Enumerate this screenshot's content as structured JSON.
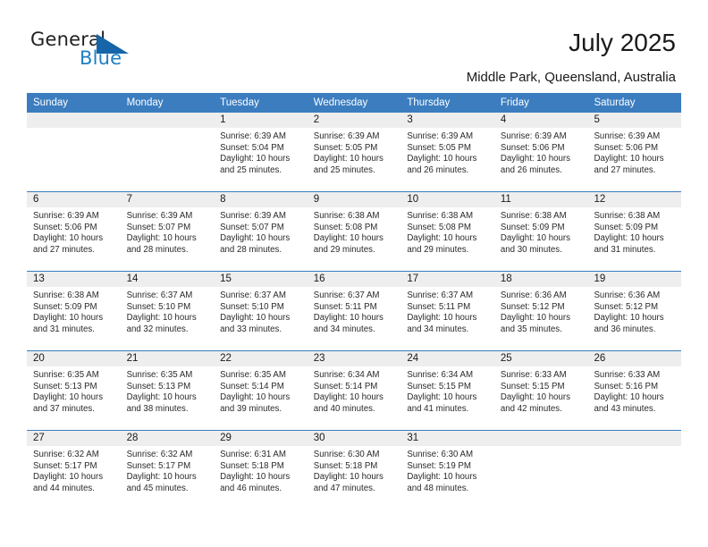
{
  "brand": {
    "name_top": "General",
    "name_bottom": "Blue",
    "accent_color": "#1565a8",
    "text_color": "#231f20"
  },
  "header": {
    "title": "July 2025",
    "subtitle": "Middle Park, Queensland, Australia"
  },
  "theme": {
    "header_blue": "#3b7dbf",
    "daynum_band": "#eeeeee"
  },
  "weekdays": [
    "Sunday",
    "Monday",
    "Tuesday",
    "Wednesday",
    "Thursday",
    "Friday",
    "Saturday"
  ],
  "weeks": [
    [
      {
        "day": "",
        "sunrise": "",
        "sunset": "",
        "daylight1": "",
        "daylight2": ""
      },
      {
        "day": "",
        "sunrise": "",
        "sunset": "",
        "daylight1": "",
        "daylight2": ""
      },
      {
        "day": "1",
        "sunrise": "Sunrise: 6:39 AM",
        "sunset": "Sunset: 5:04 PM",
        "daylight1": "Daylight: 10 hours",
        "daylight2": "and 25 minutes."
      },
      {
        "day": "2",
        "sunrise": "Sunrise: 6:39 AM",
        "sunset": "Sunset: 5:05 PM",
        "daylight1": "Daylight: 10 hours",
        "daylight2": "and 25 minutes."
      },
      {
        "day": "3",
        "sunrise": "Sunrise: 6:39 AM",
        "sunset": "Sunset: 5:05 PM",
        "daylight1": "Daylight: 10 hours",
        "daylight2": "and 26 minutes."
      },
      {
        "day": "4",
        "sunrise": "Sunrise: 6:39 AM",
        "sunset": "Sunset: 5:06 PM",
        "daylight1": "Daylight: 10 hours",
        "daylight2": "and 26 minutes."
      },
      {
        "day": "5",
        "sunrise": "Sunrise: 6:39 AM",
        "sunset": "Sunset: 5:06 PM",
        "daylight1": "Daylight: 10 hours",
        "daylight2": "and 27 minutes."
      }
    ],
    [
      {
        "day": "6",
        "sunrise": "Sunrise: 6:39 AM",
        "sunset": "Sunset: 5:06 PM",
        "daylight1": "Daylight: 10 hours",
        "daylight2": "and 27 minutes."
      },
      {
        "day": "7",
        "sunrise": "Sunrise: 6:39 AM",
        "sunset": "Sunset: 5:07 PM",
        "daylight1": "Daylight: 10 hours",
        "daylight2": "and 28 minutes."
      },
      {
        "day": "8",
        "sunrise": "Sunrise: 6:39 AM",
        "sunset": "Sunset: 5:07 PM",
        "daylight1": "Daylight: 10 hours",
        "daylight2": "and 28 minutes."
      },
      {
        "day": "9",
        "sunrise": "Sunrise: 6:38 AM",
        "sunset": "Sunset: 5:08 PM",
        "daylight1": "Daylight: 10 hours",
        "daylight2": "and 29 minutes."
      },
      {
        "day": "10",
        "sunrise": "Sunrise: 6:38 AM",
        "sunset": "Sunset: 5:08 PM",
        "daylight1": "Daylight: 10 hours",
        "daylight2": "and 29 minutes."
      },
      {
        "day": "11",
        "sunrise": "Sunrise: 6:38 AM",
        "sunset": "Sunset: 5:09 PM",
        "daylight1": "Daylight: 10 hours",
        "daylight2": "and 30 minutes."
      },
      {
        "day": "12",
        "sunrise": "Sunrise: 6:38 AM",
        "sunset": "Sunset: 5:09 PM",
        "daylight1": "Daylight: 10 hours",
        "daylight2": "and 31 minutes."
      }
    ],
    [
      {
        "day": "13",
        "sunrise": "Sunrise: 6:38 AM",
        "sunset": "Sunset: 5:09 PM",
        "daylight1": "Daylight: 10 hours",
        "daylight2": "and 31 minutes."
      },
      {
        "day": "14",
        "sunrise": "Sunrise: 6:37 AM",
        "sunset": "Sunset: 5:10 PM",
        "daylight1": "Daylight: 10 hours",
        "daylight2": "and 32 minutes."
      },
      {
        "day": "15",
        "sunrise": "Sunrise: 6:37 AM",
        "sunset": "Sunset: 5:10 PM",
        "daylight1": "Daylight: 10 hours",
        "daylight2": "and 33 minutes."
      },
      {
        "day": "16",
        "sunrise": "Sunrise: 6:37 AM",
        "sunset": "Sunset: 5:11 PM",
        "daylight1": "Daylight: 10 hours",
        "daylight2": "and 34 minutes."
      },
      {
        "day": "17",
        "sunrise": "Sunrise: 6:37 AM",
        "sunset": "Sunset: 5:11 PM",
        "daylight1": "Daylight: 10 hours",
        "daylight2": "and 34 minutes."
      },
      {
        "day": "18",
        "sunrise": "Sunrise: 6:36 AM",
        "sunset": "Sunset: 5:12 PM",
        "daylight1": "Daylight: 10 hours",
        "daylight2": "and 35 minutes."
      },
      {
        "day": "19",
        "sunrise": "Sunrise: 6:36 AM",
        "sunset": "Sunset: 5:12 PM",
        "daylight1": "Daylight: 10 hours",
        "daylight2": "and 36 minutes."
      }
    ],
    [
      {
        "day": "20",
        "sunrise": "Sunrise: 6:35 AM",
        "sunset": "Sunset: 5:13 PM",
        "daylight1": "Daylight: 10 hours",
        "daylight2": "and 37 minutes."
      },
      {
        "day": "21",
        "sunrise": "Sunrise: 6:35 AM",
        "sunset": "Sunset: 5:13 PM",
        "daylight1": "Daylight: 10 hours",
        "daylight2": "and 38 minutes."
      },
      {
        "day": "22",
        "sunrise": "Sunrise: 6:35 AM",
        "sunset": "Sunset: 5:14 PM",
        "daylight1": "Daylight: 10 hours",
        "daylight2": "and 39 minutes."
      },
      {
        "day": "23",
        "sunrise": "Sunrise: 6:34 AM",
        "sunset": "Sunset: 5:14 PM",
        "daylight1": "Daylight: 10 hours",
        "daylight2": "and 40 minutes."
      },
      {
        "day": "24",
        "sunrise": "Sunrise: 6:34 AM",
        "sunset": "Sunset: 5:15 PM",
        "daylight1": "Daylight: 10 hours",
        "daylight2": "and 41 minutes."
      },
      {
        "day": "25",
        "sunrise": "Sunrise: 6:33 AM",
        "sunset": "Sunset: 5:15 PM",
        "daylight1": "Daylight: 10 hours",
        "daylight2": "and 42 minutes."
      },
      {
        "day": "26",
        "sunrise": "Sunrise: 6:33 AM",
        "sunset": "Sunset: 5:16 PM",
        "daylight1": "Daylight: 10 hours",
        "daylight2": "and 43 minutes."
      }
    ],
    [
      {
        "day": "27",
        "sunrise": "Sunrise: 6:32 AM",
        "sunset": "Sunset: 5:17 PM",
        "daylight1": "Daylight: 10 hours",
        "daylight2": "and 44 minutes."
      },
      {
        "day": "28",
        "sunrise": "Sunrise: 6:32 AM",
        "sunset": "Sunset: 5:17 PM",
        "daylight1": "Daylight: 10 hours",
        "daylight2": "and 45 minutes."
      },
      {
        "day": "29",
        "sunrise": "Sunrise: 6:31 AM",
        "sunset": "Sunset: 5:18 PM",
        "daylight1": "Daylight: 10 hours",
        "daylight2": "and 46 minutes."
      },
      {
        "day": "30",
        "sunrise": "Sunrise: 6:30 AM",
        "sunset": "Sunset: 5:18 PM",
        "daylight1": "Daylight: 10 hours",
        "daylight2": "and 47 minutes."
      },
      {
        "day": "31",
        "sunrise": "Sunrise: 6:30 AM",
        "sunset": "Sunset: 5:19 PM",
        "daylight1": "Daylight: 10 hours",
        "daylight2": "and 48 minutes."
      },
      {
        "day": "",
        "sunrise": "",
        "sunset": "",
        "daylight1": "",
        "daylight2": ""
      },
      {
        "day": "",
        "sunrise": "",
        "sunset": "",
        "daylight1": "",
        "daylight2": ""
      }
    ]
  ]
}
